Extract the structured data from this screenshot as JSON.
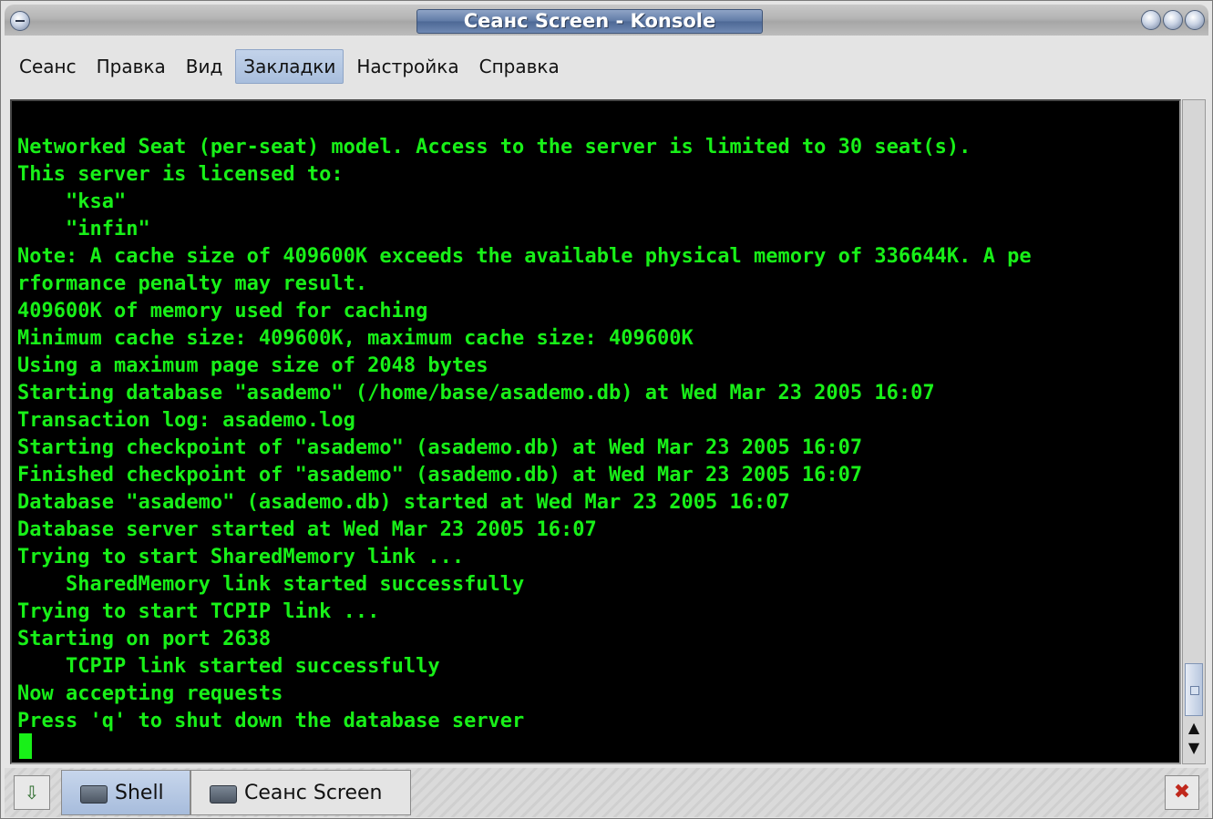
{
  "window": {
    "title": "Сеанс Screen - Konsole"
  },
  "menubar": {
    "items": [
      {
        "label": "Сеанс"
      },
      {
        "label": "Правка"
      },
      {
        "label": "Вид"
      },
      {
        "label": "Закладки",
        "active": true
      },
      {
        "label": "Настройка"
      },
      {
        "label": "Справка"
      }
    ]
  },
  "terminal": {
    "text_color": "#18f018",
    "background": "#000000",
    "lines": [
      "Networked Seat (per-seat) model. Access to the server is limited to 30 seat(s).",
      "This server is licensed to:",
      "    \"ksa\"",
      "    \"infin\"",
      "Note: A cache size of 409600K exceeds the available physical memory of 336644K. A pe",
      "rformance penalty may result.",
      "409600K of memory used for caching",
      "Minimum cache size: 409600K, maximum cache size: 409600K",
      "Using a maximum page size of 2048 bytes",
      "Starting database \"asademo\" (/home/base/asademo.db) at Wed Mar 23 2005 16:07",
      "Transaction log: asademo.log",
      "Starting checkpoint of \"asademo\" (asademo.db) at Wed Mar 23 2005 16:07",
      "Finished checkpoint of \"asademo\" (asademo.db) at Wed Mar 23 2005 16:07",
      "Database \"asademo\" (asademo.db) started at Wed Mar 23 2005 16:07",
      "Database server started at Wed Mar 23 2005 16:07",
      "Trying to start SharedMemory link ...",
      "    SharedMemory link started successfully",
      "Trying to start TCPIP link ...",
      "Starting on port 2638",
      "    TCPIP link started successfully",
      "Now accepting requests",
      "Press 'q' to shut down the database server"
    ]
  },
  "tabs": [
    {
      "label": "Shell",
      "icon": "terminal-icon",
      "active": true
    },
    {
      "label": "Сеанс Screen",
      "icon": "terminal-icon",
      "active": false
    }
  ],
  "icons": {
    "new_session": "new-session-icon",
    "close_session": "close-session-icon"
  }
}
